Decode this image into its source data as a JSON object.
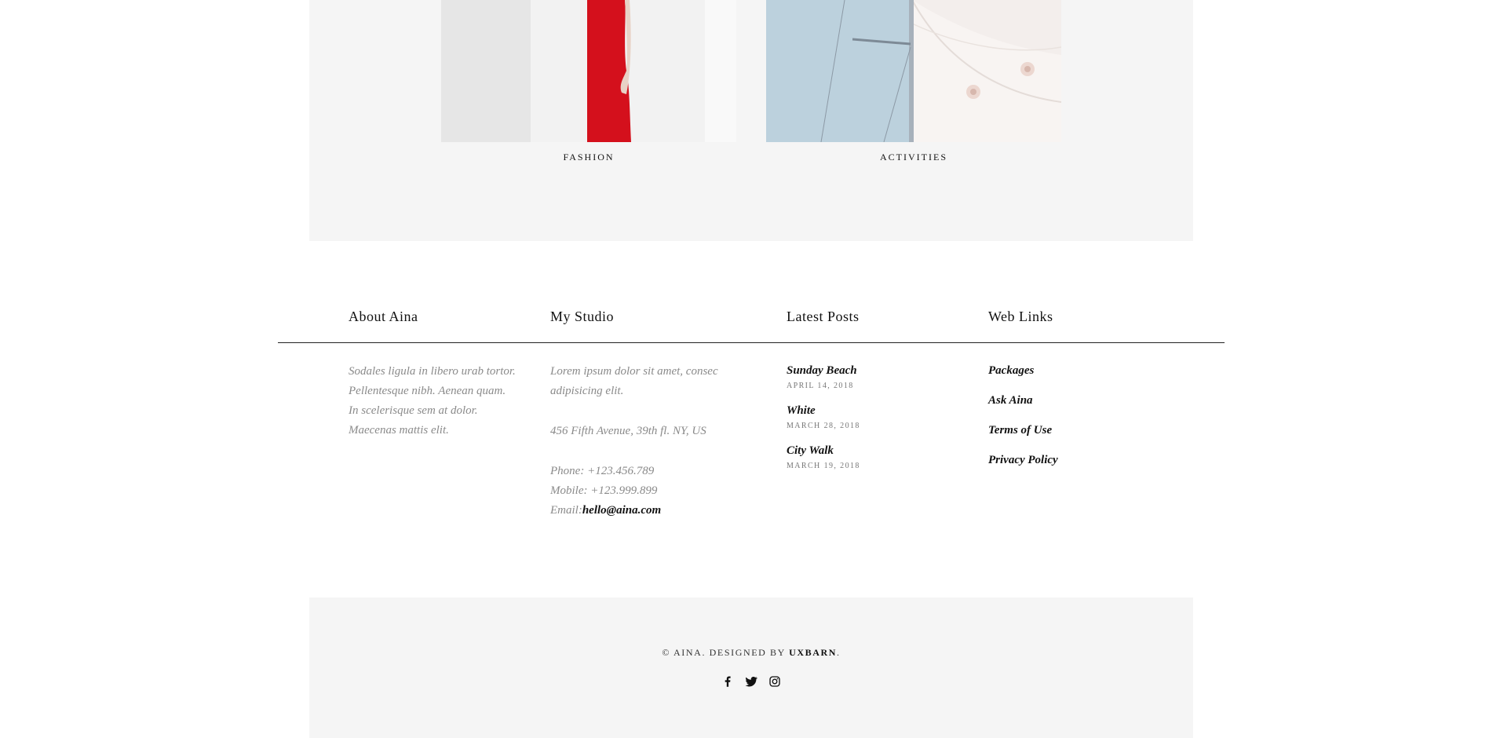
{
  "categories": [
    {
      "label": "FASHION"
    },
    {
      "label": "ACTIVITIES"
    }
  ],
  "footer_columns": {
    "about": {
      "heading": "About Aina",
      "lines": [
        "Sodales ligula in libero urab tortor.",
        "Pellentesque nibh. Aenean quam.",
        "In scelerisque sem at dolor.",
        "Maecenas mattis elit."
      ]
    },
    "studio": {
      "heading": "My Studio",
      "intro_lines": [
        "Lorem ipsum dolor sit amet, consec",
        "adipisicing elit."
      ],
      "address": "456 Fifth Avenue, 39th fl. NY, US",
      "phone": "Phone: +123.456.789",
      "mobile": "Mobile: +123.999.899",
      "email_label": "Email:",
      "email": "hello@aina.com"
    },
    "posts": {
      "heading": "Latest Posts",
      "items": [
        {
          "title": "Sunday Beach",
          "date": "APRIL 14, 2018"
        },
        {
          "title": "White",
          "date": "MARCH 28, 2018"
        },
        {
          "title": "City Walk",
          "date": "MARCH 19, 2018"
        }
      ]
    },
    "links": {
      "heading": "Web Links",
      "items": [
        "Packages",
        "Ask Aina",
        "Terms of Use",
        "Privacy Policy"
      ]
    }
  },
  "footer": {
    "copyright_prefix": "© AINA. DESIGNED BY ",
    "brand": "UXBARN",
    "suffix": ".",
    "social_icons": [
      "facebook-icon",
      "twitter-icon",
      "instagram-icon"
    ]
  },
  "colors": {
    "panel_bg": "#f5f5f5",
    "muted_text": "#8a8a8a",
    "dress_red": "#d4101c",
    "sky_blue": "#bcd1dd"
  }
}
